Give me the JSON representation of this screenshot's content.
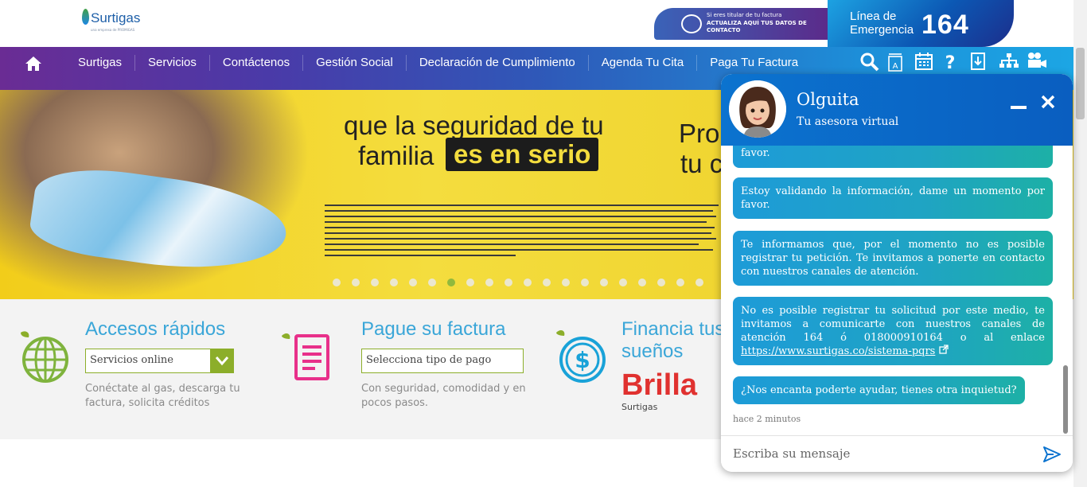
{
  "header": {
    "logo_text": "Surtigas",
    "logo_sub": "una empresa de PROMIGAS",
    "update_banner": {
      "line1": "Si eres titular de tu factura",
      "line2": "ACTUALIZA AQUÍ TUS DATOS DE CONTACTO"
    },
    "emergency": {
      "label": "Línea de Emergencia",
      "number": "164"
    }
  },
  "nav": {
    "items": [
      {
        "label": "Surtigas"
      },
      {
        "label": "Servicios"
      },
      {
        "label": "Contáctenos"
      },
      {
        "label": "Gestión Social"
      },
      {
        "label": "Declaración de Cumplimiento"
      },
      {
        "label": "Agenda Tu Cita"
      },
      {
        "label": "Paga Tu Factura"
      }
    ],
    "icons": [
      "search-icon",
      "accessibility-text-icon",
      "calendar-icon",
      "help-icon",
      "download-icon",
      "sitemap-icon",
      "video-icon"
    ]
  },
  "hero": {
    "headline1": "que la seguridad de tu",
    "headline2": "familia",
    "highlight": "es en serio",
    "right_line1": "Pro",
    "right_line2": "tu c",
    "slide_count": 20,
    "active_slide": 7,
    "active_color": "#7fb33d"
  },
  "quick_access": {
    "accesos": {
      "title": "Accesos rápidos",
      "select_value": "Servicios online",
      "desc": "Conéctate al gas, descarga tu factura, solicita créditos"
    },
    "pague": {
      "title": "Pague su factura",
      "select_value": "Selecciona tipo de pago",
      "desc": "Con seguridad, comodidad y en pocos pasos."
    },
    "financia": {
      "title_line1": "Financia tus",
      "title_line2": "sueños",
      "brand": "Brilla",
      "brand_sub": "Surtigas"
    }
  },
  "chat": {
    "name": "Olguita",
    "subtitle": "Tu asesora virtual",
    "messages": [
      {
        "text": "favor."
      },
      {
        "text": "Estoy validando la información, dame un momento por favor."
      },
      {
        "text": "Te informamos que, por el momento no es posible registrar tu petición. Te invitamos a ponerte en contacto con nuestros canales de atención."
      },
      {
        "text": "No es posible registrar tu solicitud por este medio, te invitamos a comunicarte con nuestros canales de atención 164 ó 018000910164 o al enlace",
        "link": "https://www.surtigas.co/sistema-pqrs"
      },
      {
        "text": "¿Nos encanta poderte ayudar, tienes otra inquietud?"
      }
    ],
    "timestamp": "hace 2 minutos",
    "input_placeholder": "Escriba su mensaje",
    "accent": "#0b73cf"
  }
}
